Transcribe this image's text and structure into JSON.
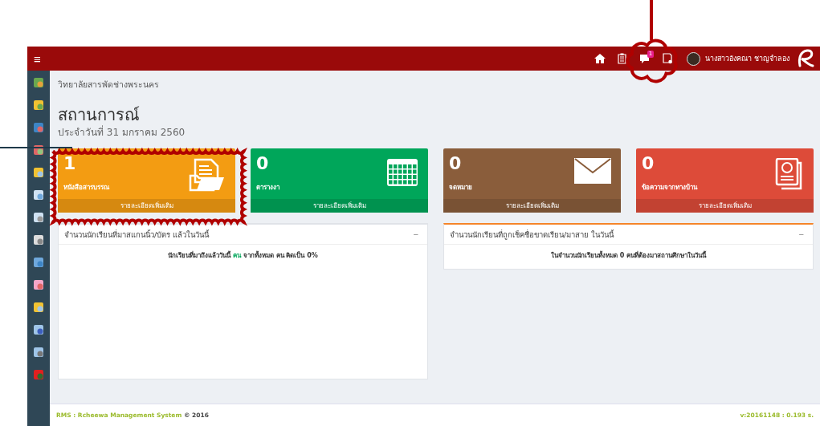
{
  "topbar": {
    "menu_glyph": "≡",
    "notification_badge": "1",
    "user_name": "นางสาวอังคณา ชาญจำลอง"
  },
  "breadcrumb": "วิทยาลัยสารพัดช่างพระนคร",
  "page_title": "สถานการณ์",
  "date": "ประจำวันที่ 31 มกราคม 2560",
  "cards": [
    {
      "kind": "folder",
      "count": "1",
      "label": "หนังสือสารบรรณ",
      "link": "รายละเอียดเพิ่มเติม",
      "color": "#f39c12"
    },
    {
      "kind": "calendar",
      "count": "0",
      "label": "ตารางงา",
      "link": "รายละเอียดเพิ่มเติม",
      "color": "#00a65a"
    },
    {
      "kind": "envelope",
      "count": "0",
      "label": "จดหมาย",
      "link": "รายละเอียดเพิ่มเติม",
      "color": "#8a5d3b"
    },
    {
      "kind": "certificate",
      "count": "0",
      "label": "ข้อความจากทางบ้าน",
      "link": "รายละเอียดเพิ่มเติม",
      "color": "#dd4b39"
    }
  ],
  "panels": [
    {
      "title": "จำนวนนักเรียนที่มาสแกนนิ้ว/บัตร แล้วในวันนี้",
      "collapse": "−",
      "accent": false,
      "body": [
        {
          "text": "นักเรียนที่มาถึงแล้ววันนี้ ",
          "highlight": false
        },
        {
          "text": "คน",
          "highlight": true
        },
        {
          "text": " จากทั้งหมด คน คิดเป็น 0%",
          "highlight": false
        }
      ]
    },
    {
      "title": "จำนวนนักเรียนที่ถูกเช็คชื่อขาดเรียน/มาสาย ในวันนี้",
      "collapse": "−",
      "accent": true,
      "body": [
        {
          "text": "ในจำนวนนักเรียนทั้งหมด 0 คนที่ต้องมาสถานศึกษาในวันนี้",
          "highlight": false
        }
      ]
    }
  ],
  "footer": {
    "app_name": "RMS : Rcheewa Management System",
    "copyright": "© 2016",
    "version": "v:20161148 : 0.193 s."
  }
}
